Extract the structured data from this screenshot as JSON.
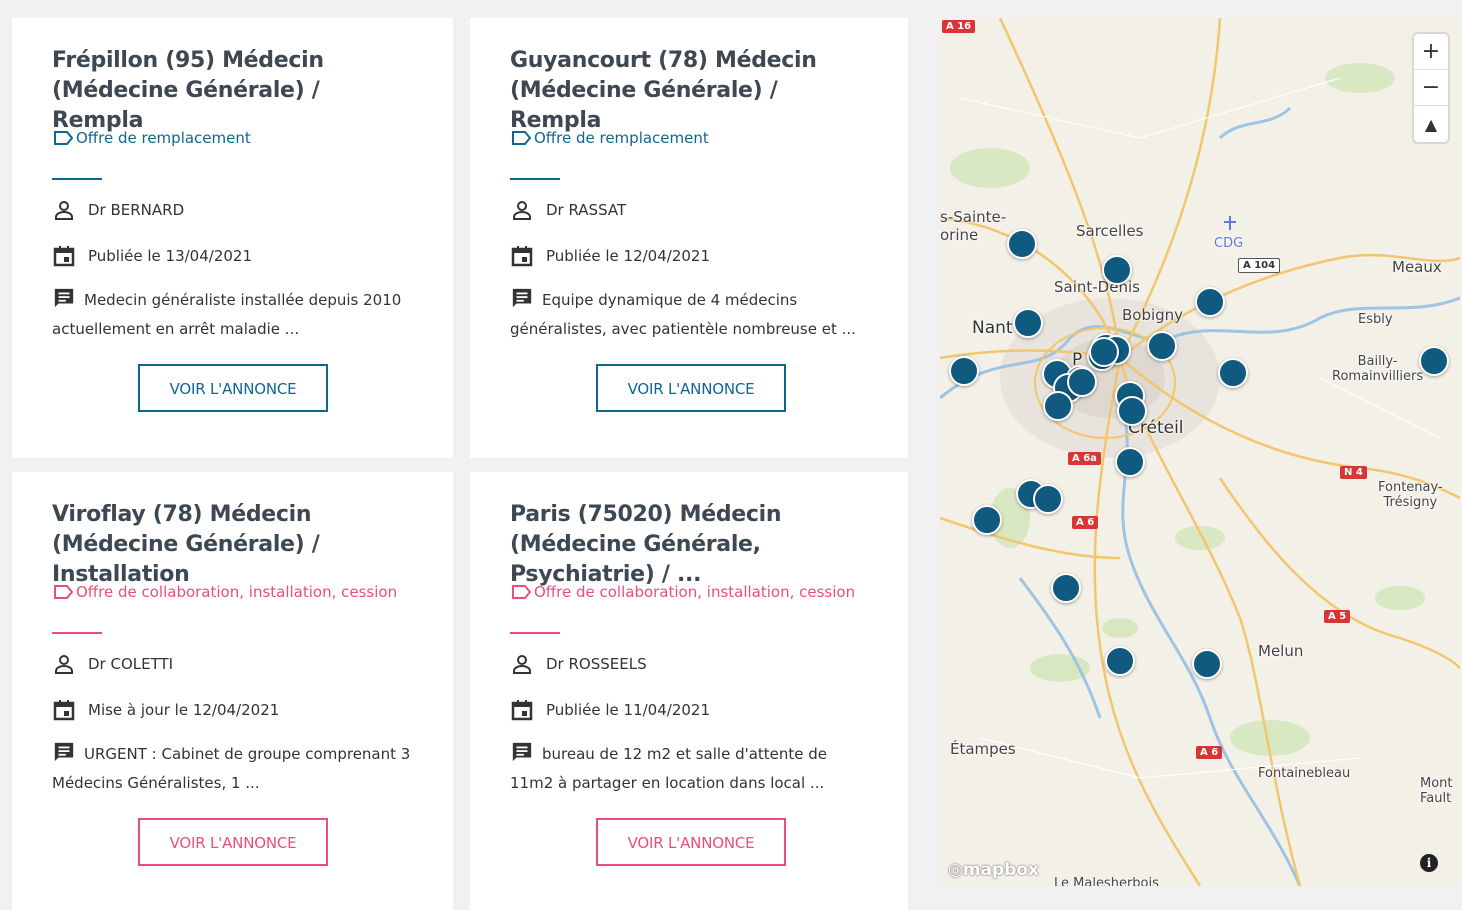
{
  "listings": [
    {
      "title": "Frépillon (95) Médecin (Médecine Générale) / Rempla",
      "offer_type": "Offre de remplacement",
      "kind": "remplacement",
      "doctor": "Dr BERNARD",
      "date": "Publiée le 13/04/2021",
      "description": "Medecin généraliste installée depuis 2010 actuellement en arrêt maladie ...",
      "button": "VOIR L'ANNONCE"
    },
    {
      "title": "Guyancourt (78) Médecin (Médecine Générale) / Rempla",
      "offer_type": "Offre de remplacement",
      "kind": "remplacement",
      "doctor": "Dr RASSAT",
      "date": "Publiée le 12/04/2021",
      "description": "Equipe dynamique de 4 médecins généralistes, avec patientèle nombreuse et ...",
      "button": "VOIR L'ANNONCE"
    },
    {
      "title": "Viroflay (78) Médecin (Médecine Générale) / Installation",
      "offer_type": "Offre de collaboration, installation, cession",
      "kind": "collaboration",
      "doctor": "Dr COLETTI",
      "date": "Mise à jour le 12/04/2021",
      "description": "URGENT : Cabinet de groupe comprenant 3 Médecins Généralistes, 1 ...",
      "button": "VOIR L'ANNONCE"
    },
    {
      "title": "Paris (75020) Médecin (Médecine Générale, Psychiatrie) / ...",
      "offer_type": "Offre de collaboration, installation, cession",
      "kind": "collaboration",
      "doctor": "Dr ROSSEELS",
      "date": "Publiée le 11/04/2021",
      "description": "bureau de 12 m2 et salle d'attente de 11m2 à partager en location dans local ...",
      "button": "VOIR L'ANNONCE"
    }
  ],
  "colors": {
    "remplacement": "#0f6690",
    "collaboration": "#ec4e7b",
    "marker": "#10597f"
  },
  "icons": {
    "offer": "tag-icon",
    "doctor": "person-icon",
    "date": "calendar-icon",
    "description": "message-icon"
  },
  "map": {
    "places": {
      "sarcelles": "Sarcelles",
      "saint_denis": "Saint-Denis",
      "bobigny": "Bobigny",
      "nanterre": "Nant",
      "paris": "P",
      "creteil": "Créteil",
      "meaux": "Meaux",
      "esbly": "Esbly",
      "bailly": "Bailly-\nRomainvilliers",
      "fontenay": "Fontenay-\nTrésigny",
      "melun": "Melun",
      "etampes": "Étampes",
      "fontainebleau": "Fontainebleau",
      "montfault": "Mont\nFault",
      "malesherbois": "Le Malesherbois",
      "sainte": "s-Sainte-\norine",
      "cdg": "CDG"
    },
    "roads": {
      "a16": "A 16",
      "a104": "A 104",
      "a6a": "A 6a",
      "a6": "A 6",
      "a6_south": "A 6",
      "n4": "N 4",
      "a5": "A 5"
    },
    "controls": {
      "zoom_in": "+",
      "zoom_out": "−",
      "compass": "▲"
    },
    "logo": "mapbox",
    "info": "i",
    "marker_count": 26
  }
}
